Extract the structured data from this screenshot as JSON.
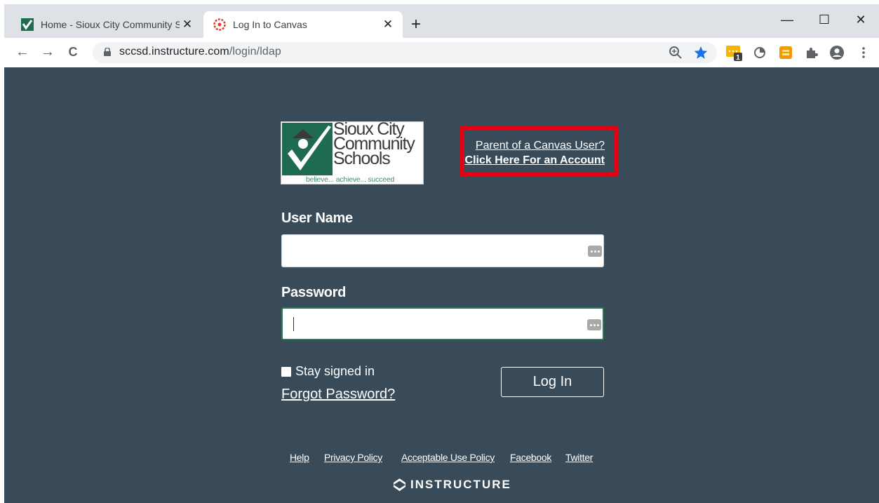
{
  "browser": {
    "tabs": [
      {
        "title": "Home - Sioux City Community Sc",
        "active": false,
        "favicon": "school-checkmark-icon"
      },
      {
        "title": "Log In to Canvas",
        "active": true,
        "favicon": "canvas-icon"
      }
    ],
    "new_tab_label": "+",
    "window_controls": {
      "minimize": "—",
      "maximize": "☐",
      "close": "✕"
    },
    "nav": {
      "back": "←",
      "forward": "→",
      "reload": "C"
    },
    "url": {
      "domain": "sccsd.instructure.com",
      "path": "/login/ldap"
    },
    "extension_badge": "1"
  },
  "page": {
    "logo": {
      "name_lines": [
        "Sioux City",
        "Community",
        "Schools"
      ],
      "tagline": "believe... achieve... succeed"
    },
    "parent_link": {
      "line1": "Parent of a Canvas User?",
      "line2": "Click Here For an Account"
    },
    "form": {
      "username_label": "User Name",
      "username_value": "",
      "password_label": "Password",
      "password_value": "",
      "stay_signed_in": "Stay signed in",
      "forgot_password": "Forgot Password?",
      "login_button": "Log In"
    },
    "footer": {
      "links": [
        "Help",
        "Privacy Policy",
        "Acceptable Use Policy",
        "Facebook",
        "Twitter"
      ],
      "brand": "INSTRUCTURE"
    }
  },
  "colors": {
    "page_background": "#394b58",
    "highlight_border": "#e60012",
    "focus_border": "#2d7a5a",
    "logo_green": "#1e6b52",
    "bookmark_star": "#1a73e8"
  }
}
